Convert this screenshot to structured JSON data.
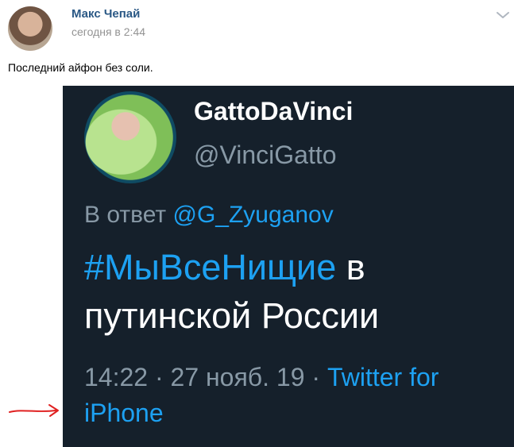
{
  "post": {
    "author": "Макс Чепай",
    "time": "сегодня в 2:44",
    "text": "Последний айфон без соли."
  },
  "icons": {
    "avatar": "user-avatar",
    "menu": "chevron-down-icon",
    "arrow": "red-arrow-icon"
  },
  "tweet": {
    "name": "GattoDaVinci",
    "handle": "@VinciGatto",
    "reply_prefix": "В ответ",
    "reply_to": "@G_Zyuganov",
    "hashtag": "#МыВсеНищие",
    "body_rest_line1": " в",
    "body_line2": "путинской России",
    "time_date": "14:22 · 27 нояб. 19 · ",
    "client_part1": "Twitter for",
    "client_part2": "iPhone"
  },
  "colors": {
    "author": "#2a5885",
    "tweet_bg": "#15202b",
    "tweet_link": "#1da1f2",
    "tweet_secondary": "#8899a6",
    "arrow": "#e02020"
  }
}
